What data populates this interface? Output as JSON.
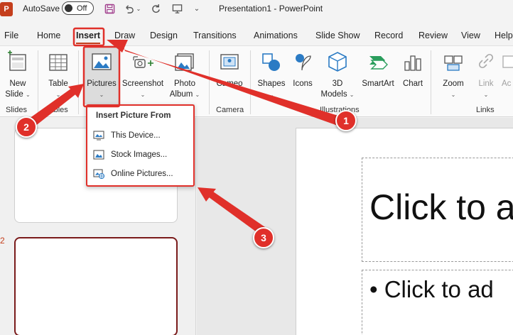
{
  "titlebar": {
    "logo": "P",
    "autosave_label": "AutoSave",
    "toggle_state": "Off",
    "document_title": "Presentation1  -  PowerPoint"
  },
  "tabs": [
    {
      "label": "File"
    },
    {
      "label": "Home"
    },
    {
      "label": "Insert"
    },
    {
      "label": "Draw"
    },
    {
      "label": "Design"
    },
    {
      "label": "Transitions"
    },
    {
      "label": "Animations"
    },
    {
      "label": "Slide Show"
    },
    {
      "label": "Record"
    },
    {
      "label": "Review"
    },
    {
      "label": "View"
    },
    {
      "label": "Help"
    }
  ],
  "active_tab": "Insert",
  "ribbon": {
    "new_slide": [
      "New",
      "Slide"
    ],
    "table": "Table",
    "pictures": "Pictures",
    "screenshot": "Screenshot",
    "photo_album": [
      "Photo",
      "Album"
    ],
    "cameo": "Cameo",
    "shapes": "Shapes",
    "icons": "Icons",
    "models_3d": [
      "3D",
      "Models"
    ],
    "smartart": "SmartArt",
    "chart": "Chart",
    "zoom": "Zoom",
    "link": "Link",
    "action_partial": "Ac",
    "groups": {
      "slides": "Slides",
      "tables": "Tables",
      "camera": "Camera",
      "illustrations": "Illustrations",
      "links": "Links"
    }
  },
  "dropdown": {
    "title": "Insert Picture From",
    "items": [
      {
        "label": "This Device..."
      },
      {
        "label": "Stock Images..."
      },
      {
        "label": "Online Pictures..."
      }
    ]
  },
  "slides_panel": {
    "second_slide_number": "2"
  },
  "slide": {
    "title_placeholder": "Click to a",
    "body_placeholder": "• Click to ad"
  },
  "annotations": {
    "badges": [
      "1",
      "2",
      "3"
    ],
    "color": "#e0302a"
  },
  "colors": {
    "accent": "#c43e1c",
    "annotation": "#e0302a",
    "selected_slide_border": "#7a1b1b"
  }
}
